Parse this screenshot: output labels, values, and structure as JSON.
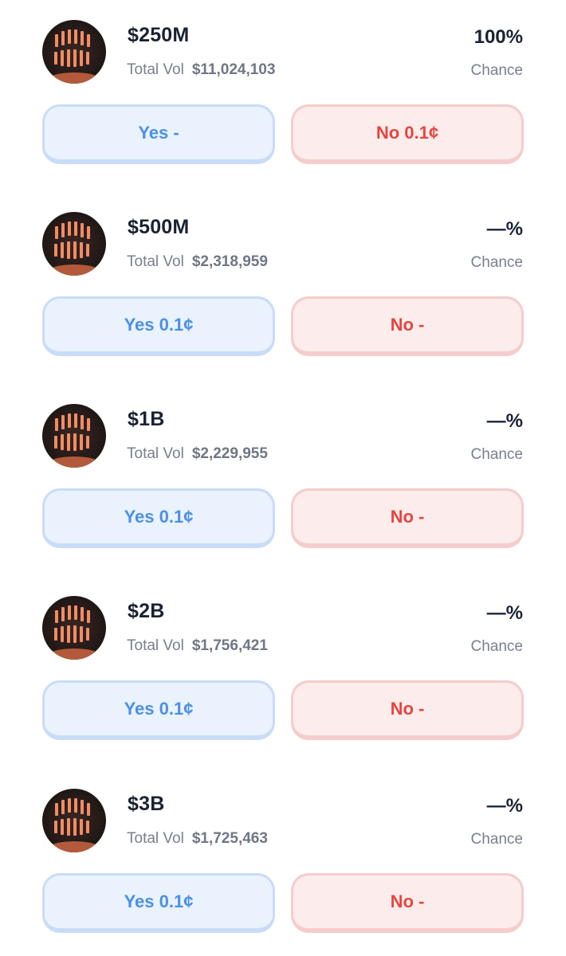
{
  "markets": [
    {
      "title": "$250M",
      "vol_label": "Total Vol",
      "vol_value": "$11,024,103",
      "percent": "100%",
      "chance_label": "Chance",
      "yes_label": "Yes -",
      "no_label": "No 0.1¢",
      "icon": "market-image"
    },
    {
      "title": "$500M",
      "vol_label": "Total Vol",
      "vol_value": "$2,318,959",
      "percent": "—%",
      "chance_label": "Chance",
      "yes_label": "Yes 0.1¢",
      "no_label": "No -",
      "icon": "market-image"
    },
    {
      "title": "$1B",
      "vol_label": "Total Vol",
      "vol_value": "$2,229,955",
      "percent": "—%",
      "chance_label": "Chance",
      "yes_label": "Yes 0.1¢",
      "no_label": "No -",
      "icon": "market-image"
    },
    {
      "title": "$2B",
      "vol_label": "Total Vol",
      "vol_value": "$1,756,421",
      "percent": "—%",
      "chance_label": "Chance",
      "yes_label": "Yes 0.1¢",
      "no_label": "No -",
      "icon": "market-image"
    },
    {
      "title": "$3B",
      "vol_label": "Total Vol",
      "vol_value": "$1,725,463",
      "percent": "—%",
      "chance_label": "Chance",
      "yes_label": "Yes 0.1¢",
      "no_label": "No -",
      "icon": "market-image"
    }
  ],
  "colors": {
    "yes_text": "#4a90e6",
    "yes_bg": "#eaf2fd",
    "no_text": "#e5463f",
    "no_bg": "#fdecec",
    "title_text": "#1a2232",
    "muted_text": "#78808c"
  }
}
